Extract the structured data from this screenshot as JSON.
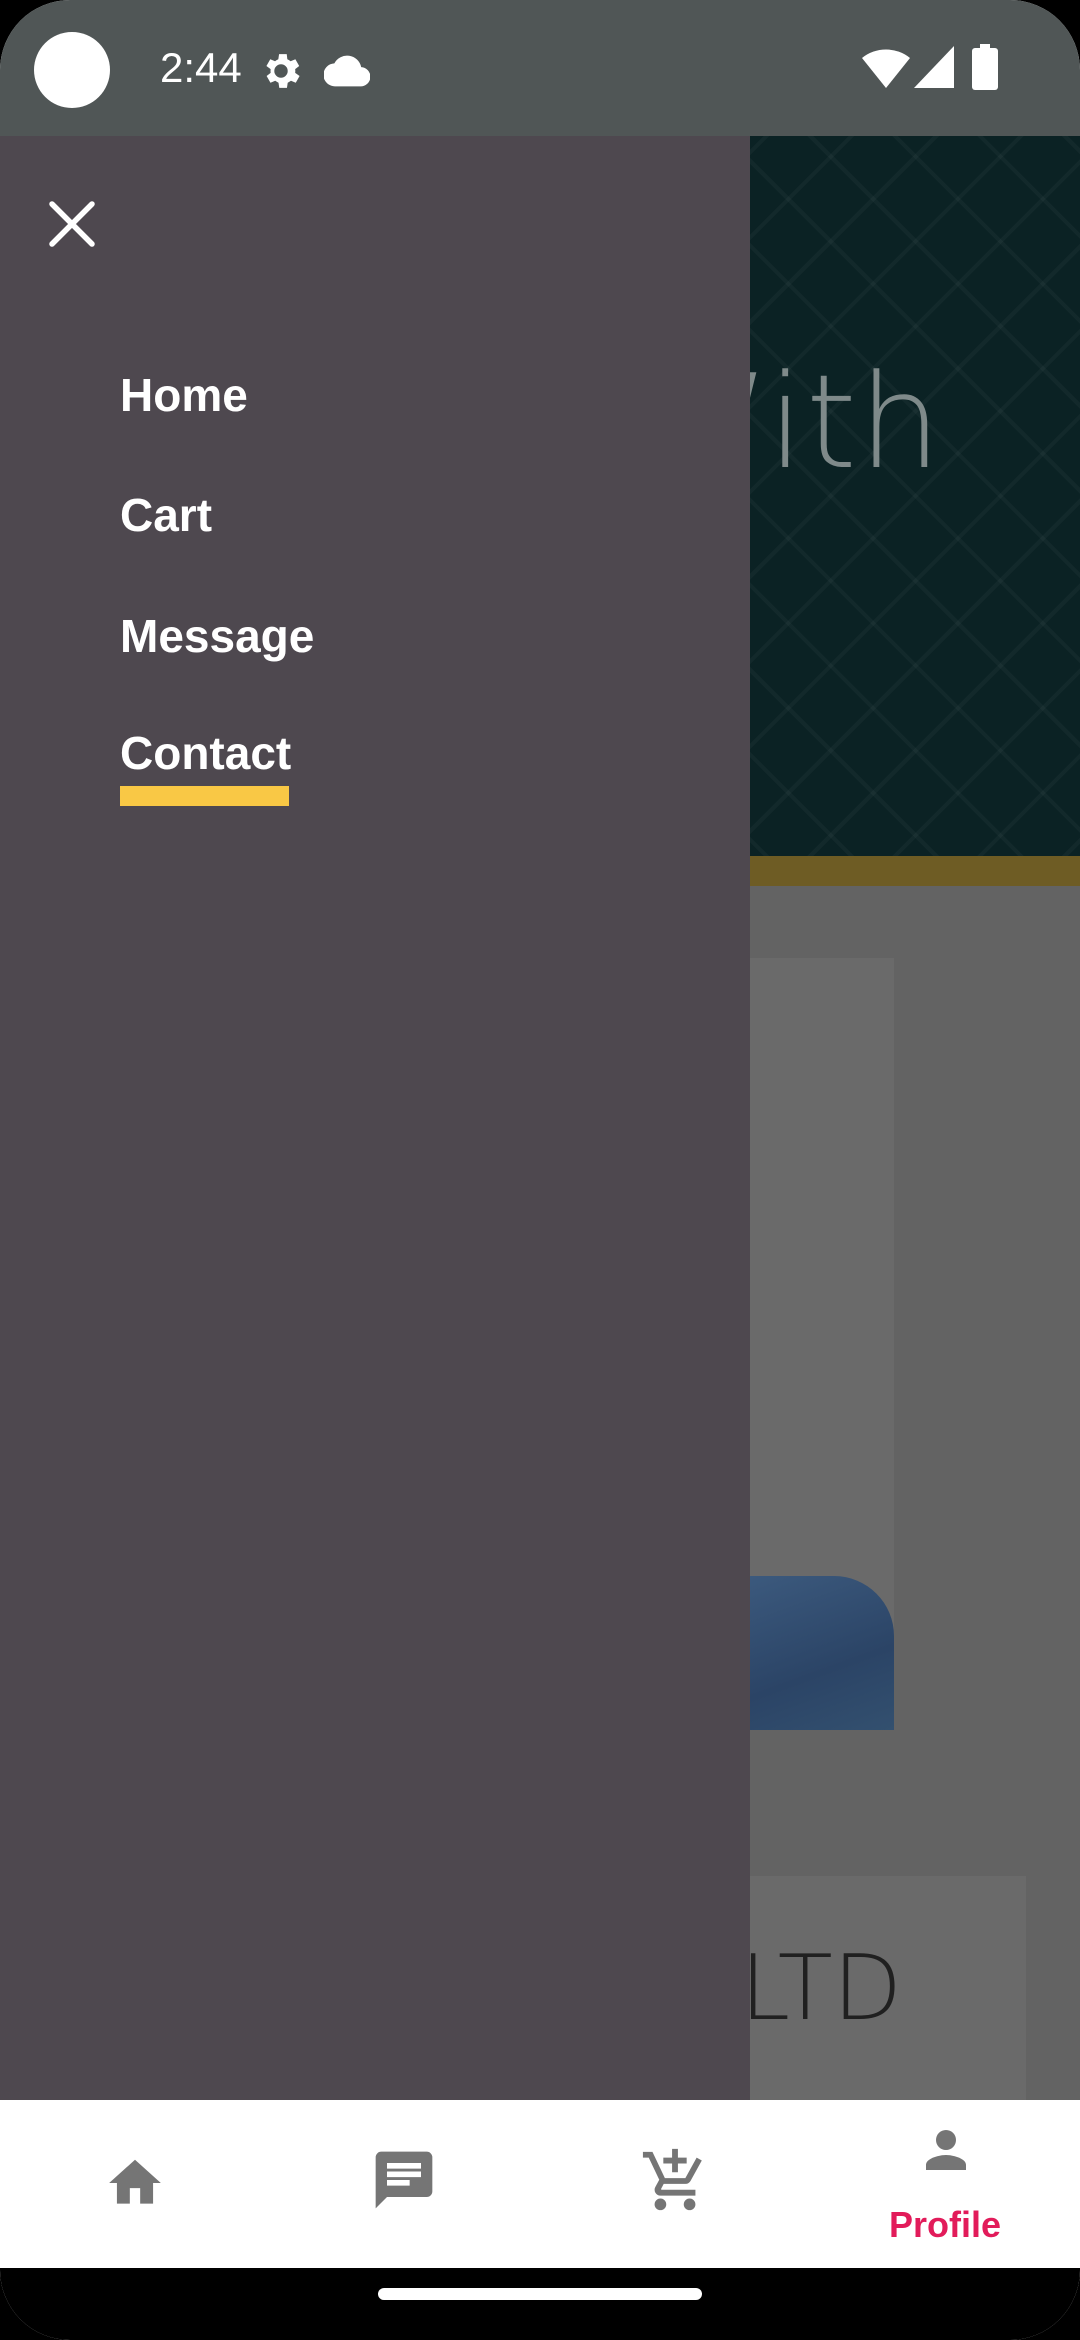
{
  "status_bar": {
    "time": "2:44",
    "icons": [
      "settings-icon",
      "cloud-icon",
      "wifi-icon",
      "signal-icon",
      "battery-icon"
    ]
  },
  "background": {
    "hero_text": "With",
    "card_text": "LTD"
  },
  "drawer": {
    "close_icon": "close-icon",
    "items": [
      {
        "label": "Home"
      },
      {
        "label": "Cart"
      },
      {
        "label": "Message"
      },
      {
        "label": "Contact",
        "active": true
      }
    ],
    "active_color": "#f9c845"
  },
  "bottom_nav": {
    "items": [
      {
        "icon": "home-icon",
        "label": ""
      },
      {
        "icon": "chat-icon",
        "label": ""
      },
      {
        "icon": "add-cart-icon",
        "label": ""
      },
      {
        "icon": "person-icon",
        "label": "Profile",
        "active": true
      }
    ],
    "active_color": "#e21b5a"
  }
}
